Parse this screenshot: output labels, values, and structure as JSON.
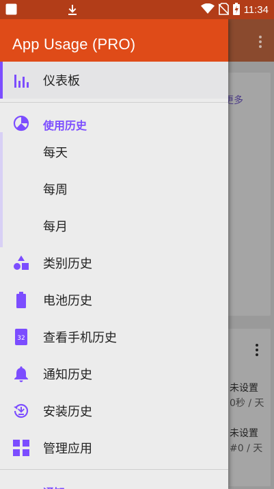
{
  "status_bar": {
    "time": "11:34",
    "icons": [
      "notification-square-icon",
      "download-icon",
      "wifi-icon",
      "no-sim-icon",
      "battery-charging-icon"
    ]
  },
  "drawer": {
    "title": "App Usage (PRO)",
    "dashboard_label": "仪表板",
    "history_section_label": "使用历史",
    "history_items": [
      "每天",
      "每周",
      "每月"
    ],
    "items": [
      {
        "label": "类别历史",
        "icon": "category-shapes-icon"
      },
      {
        "label": "电池历史",
        "icon": "battery-icon"
      },
      {
        "label": "查看手机历史",
        "icon": "calendar-32-icon",
        "badge": "32"
      },
      {
        "label": "通知历史",
        "icon": "bell-icon"
      },
      {
        "label": "安装历史",
        "icon": "install-history-icon"
      },
      {
        "label": "管理应用",
        "icon": "grid-apps-icon"
      }
    ],
    "next_section_label": "通知"
  },
  "background": {
    "more_link": "更多",
    "row1_status": "未设置",
    "row1_detail": "0秒 / 天",
    "row2_status": "未设置",
    "row2_detail": "#0 / 天"
  },
  "colors": {
    "accent": "#7c4dff",
    "header": "#df4b18",
    "status_bar": "#b23d18"
  }
}
